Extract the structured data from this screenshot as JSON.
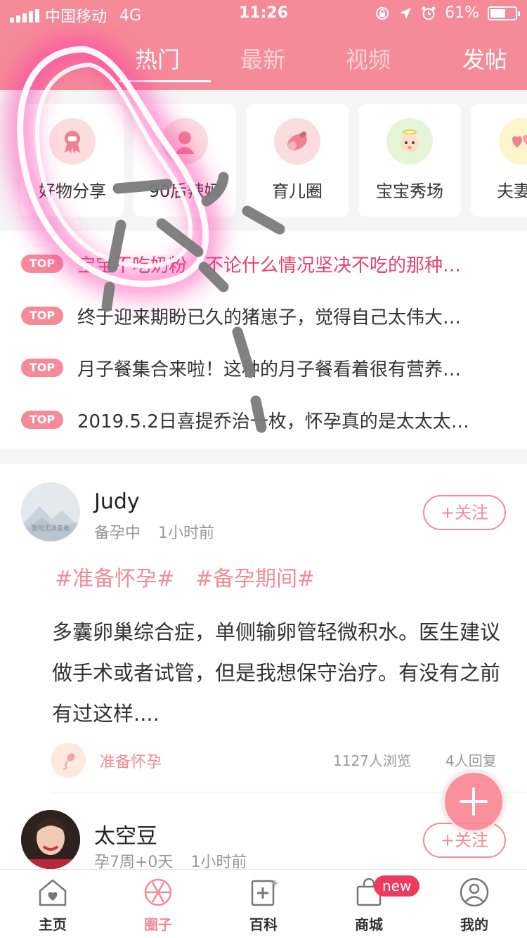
{
  "status_bar": {
    "carrier": "中国移动",
    "network": "4G",
    "time": "11:26",
    "battery_percent": "61%",
    "battery_level": 0.61
  },
  "header": {
    "tabs": [
      {
        "label": "热门",
        "active": true
      },
      {
        "label": "最新",
        "active": false
      },
      {
        "label": "视频",
        "active": false
      }
    ],
    "post_label": "发帖"
  },
  "categories": [
    {
      "label": "好物分享",
      "icon": "gift-ribbon-icon"
    },
    {
      "label": "90后辣妈",
      "icon": "mom-icon"
    },
    {
      "label": "育儿圈",
      "icon": "pacifier-icon"
    },
    {
      "label": "宝宝秀场",
      "icon": "baby-face-icon"
    },
    {
      "label": "夫妻情",
      "icon": "hearts-icon"
    }
  ],
  "top_posts": [
    {
      "badge": "TOP",
      "title": "宝宝不吃奶粉，不论什么情况坚决不吃的那种…"
    },
    {
      "badge": "TOP",
      "title": "终于迎来期盼已久的猪崽子，觉得自己太伟大…"
    },
    {
      "badge": "TOP",
      "title": "月子餐集合来啦！这种的月子餐看着很有营养…"
    },
    {
      "badge": "TOP",
      "title": "2019.5.2日喜提乔治一枚，怀孕真的是太太太…"
    }
  ],
  "feed": [
    {
      "username": "Judy",
      "status": "备孕中",
      "time": "1小时前",
      "follow_label": "+关注",
      "avatar_text": "暂时无法查看",
      "tags": [
        "#准备怀孕#",
        "#备孕期间#"
      ],
      "body": "多囊卵巢综合症，单侧输卵管轻微积水。医生建议做手术或者试管，但是我想保守治疗。有没有之前有过这样....",
      "circle": "准备怀孕",
      "views": "1127人浏览",
      "replies": "4人回复"
    },
    {
      "username": "太空豆",
      "status": "孕7周+0天",
      "time": "1小时前",
      "follow_label": "+关注"
    }
  ],
  "bottom_nav": [
    {
      "label": "主页",
      "icon": "home-heart-icon",
      "active": false
    },
    {
      "label": "圈子",
      "icon": "aperture-icon",
      "active": true
    },
    {
      "label": "百科",
      "icon": "encyclopedia-icon",
      "active": false
    },
    {
      "label": "商城",
      "icon": "shopping-bag-icon",
      "active": false,
      "badge": "new"
    },
    {
      "label": "我的",
      "icon": "profile-icon",
      "active": false
    }
  ],
  "colors": {
    "brand": "#f58a98",
    "hot_text": "#e8406a",
    "badge_new": "#ee3a5c"
  }
}
